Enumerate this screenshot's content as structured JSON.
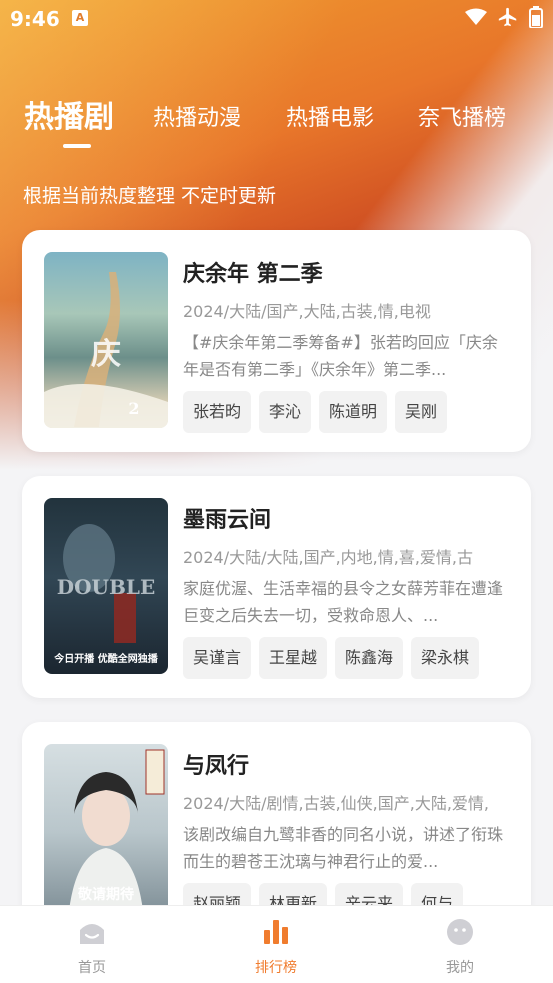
{
  "status_bar": {
    "time": "9:46",
    "notification_icon": "A"
  },
  "tabs": [
    {
      "label": "热播剧",
      "active": true
    },
    {
      "label": "热播动漫",
      "active": false
    },
    {
      "label": "热播电影",
      "active": false
    },
    {
      "label": "奈飞播榜",
      "active": false
    }
  ],
  "subtitle": "根据当前热度整理 不定时更新",
  "items": [
    {
      "title": "庆余年 第二季",
      "meta": "2024/大陆/国产,大陆,古装,情,电视",
      "desc": "【#庆余年第二季筹备#】张若昀回应「庆余年是否有第二季」《庆余年》第二季...",
      "cast": [
        "张若昀",
        "李沁",
        "陈道明",
        "吴刚"
      ],
      "poster_colors": [
        "#6fa3b8",
        "#c9b48a"
      ]
    },
    {
      "title": "墨雨云间",
      "meta": "2024/大陆/大陆,国产,内地,情,喜,爱情,古",
      "desc": "家庭优渥、生活幸福的县令之女薛芳菲在遭逢巨变之后失去一切，受救命恩人、...",
      "cast": [
        "吴谨言",
        "王星越",
        "陈鑫海",
        "梁永棋"
      ],
      "poster_colors": [
        "#1c2a33",
        "#3d5566"
      ],
      "poster_caption": "今日开播 优酷全网独播"
    },
    {
      "title": "与凤行",
      "meta": "2024/大陆/剧情,古装,仙侠,国产,大陆,爱情,",
      "desc": "该剧改编自九鹭非香的同名小说，讲述了衔珠而生的碧苍王沈璃与神君行止的爱...",
      "cast": [
        "赵丽颖",
        "林更新",
        "辛云来",
        "何与"
      ],
      "poster_colors": [
        "#c9d3d6",
        "#8a9aa2"
      ],
      "poster_caption": "敬请期待"
    }
  ],
  "bottom_nav": [
    {
      "label": "首页",
      "icon": "home-icon",
      "active": false
    },
    {
      "label": "排行榜",
      "icon": "bar-chart-icon",
      "active": true
    },
    {
      "label": "我的",
      "icon": "profile-icon",
      "active": false
    }
  ],
  "colors": {
    "accent": "#f07c2e",
    "hero_top": "#f0a030",
    "hero_bottom": "#a02418"
  }
}
